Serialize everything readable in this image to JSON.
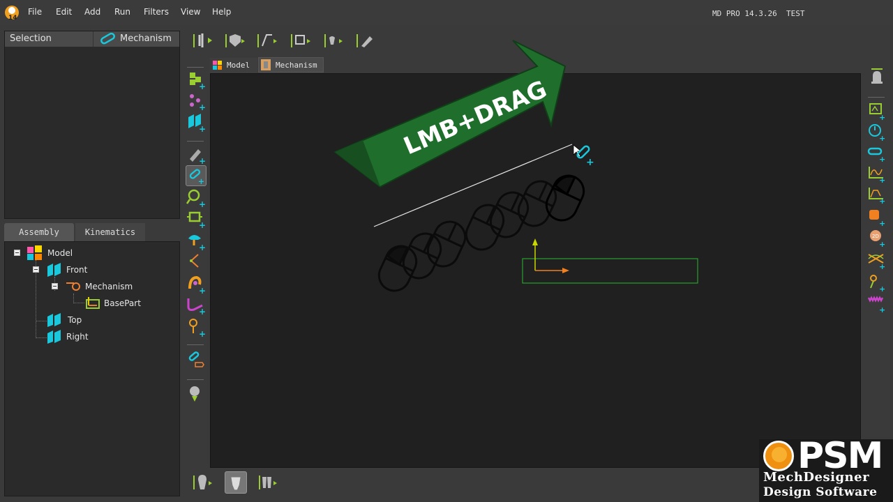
{
  "menu": {
    "items": [
      "File",
      "Edit",
      "Add",
      "Run",
      "Filters",
      "View",
      "Help"
    ],
    "version": "MD PRO 14.3.26  TEST"
  },
  "selection_panel": {
    "title": "Selection",
    "context_label": "Mechanism"
  },
  "tree_tabs": [
    "Assembly",
    "Kinematics"
  ],
  "tree": {
    "model": "Model",
    "front": "Front",
    "mechanism": "Mechanism",
    "basepart": "BasePart",
    "top": "Top",
    "right": "Right"
  },
  "doc_tabs": {
    "model": "Model",
    "mechanism": "Mechanism"
  },
  "canvas": {
    "instruction": "LMB+DRAG"
  },
  "logo": {
    "brand": "PSM",
    "line1": "MechDesigner",
    "line2": "Design Software"
  },
  "colors": {
    "accent_green": "#9acd32",
    "cyan_icon": "#19c8dc",
    "arrow_green": "#1f6e2c",
    "orange": "#f09010"
  }
}
